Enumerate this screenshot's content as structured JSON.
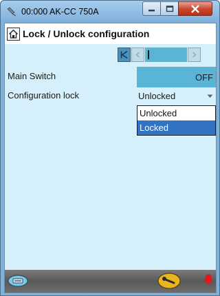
{
  "window": {
    "title": "00:000 AK-CC 750A",
    "icons": [
      "app-icon",
      "minimize-icon",
      "maximize-icon",
      "close-icon"
    ]
  },
  "header": {
    "title": "Lock / Unlock configuration",
    "home_icon": "home-icon"
  },
  "pager": {
    "icons": [
      "first-page-icon",
      "prev-page-icon",
      "next-page-icon"
    ]
  },
  "rows": [
    {
      "label": "Main Switch",
      "value": "OFF"
    },
    {
      "label": "Configuration lock",
      "value": "Unlocked"
    }
  ],
  "dropdown": {
    "options": [
      "Unlocked",
      "Locked"
    ],
    "highlighted": "Locked"
  },
  "footer": {
    "icons": [
      "device-icon",
      "service-tool-icon",
      "alarm-bell-icon"
    ]
  },
  "colors": {
    "accent": "#5ab4d6",
    "background": "#d5f0fa",
    "selection": "#3373c4",
    "alarm": "#e8141a"
  }
}
